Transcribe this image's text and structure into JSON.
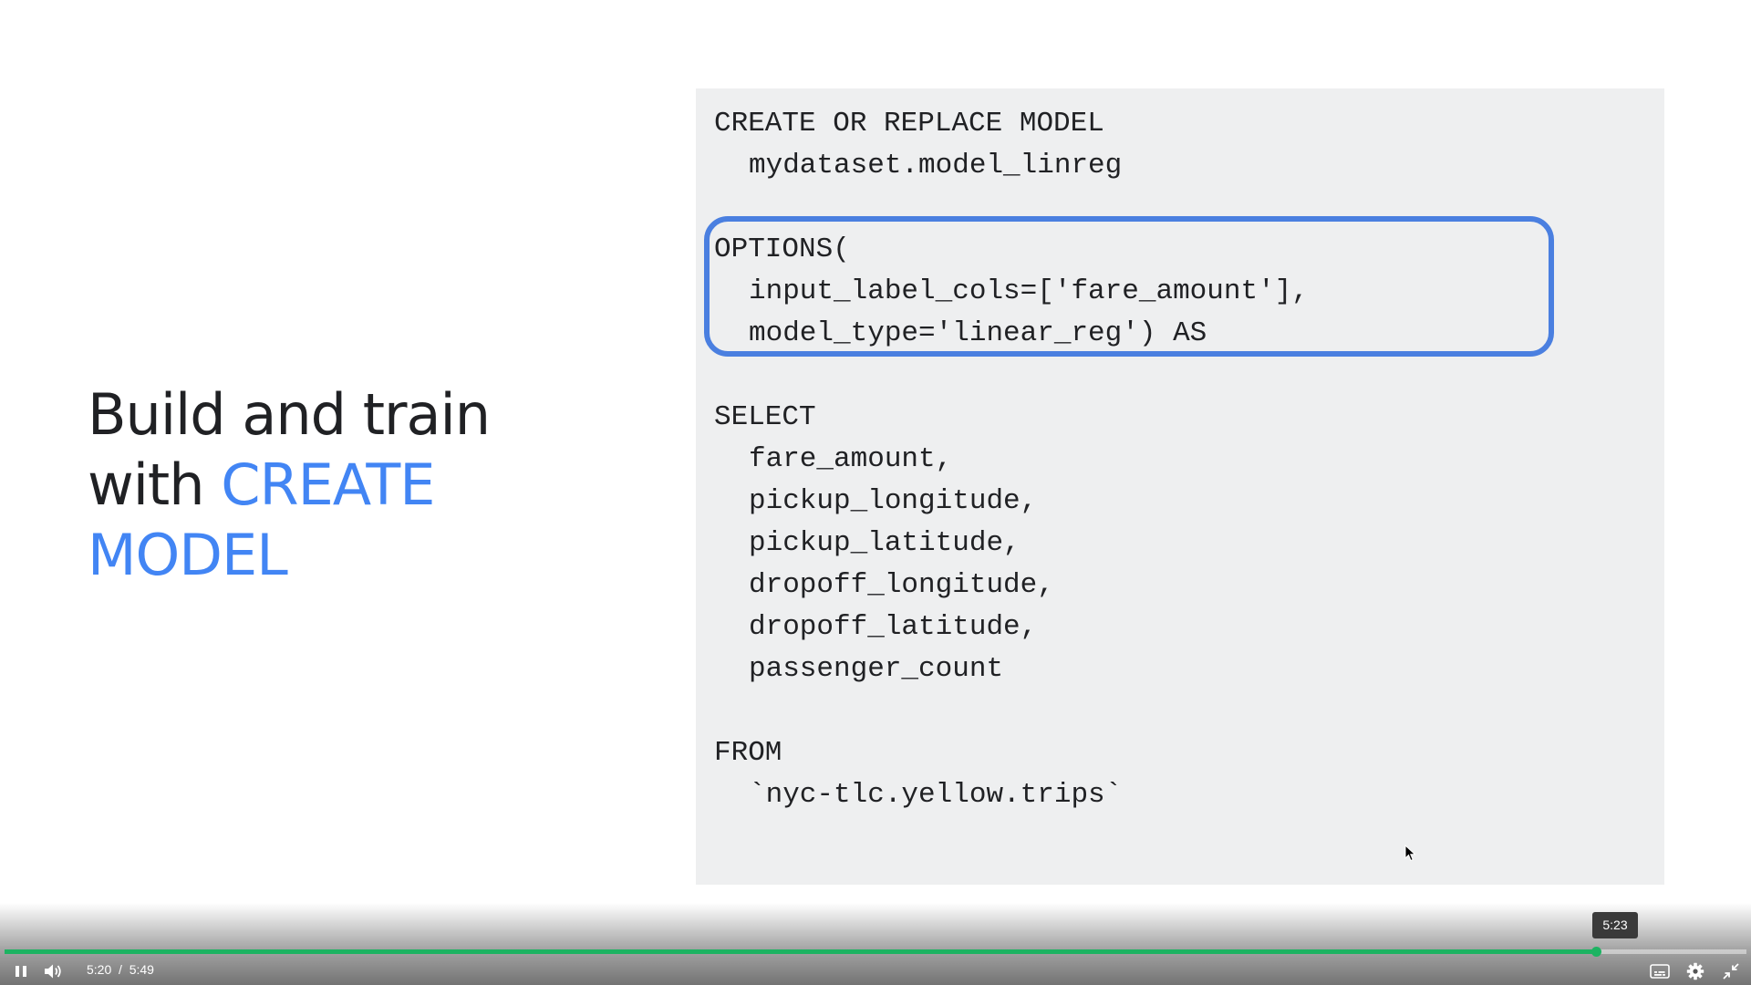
{
  "slide": {
    "heading_line1": "Build and train",
    "heading_line2_prefix": "with ",
    "heading_line2_accent": "CREATE",
    "heading_line3_accent": "MODEL"
  },
  "code": {
    "line1": "CREATE OR REPLACE MODEL",
    "line2": "mydataset.model_linreg",
    "line3": "OPTIONS(",
    "line4": "input_label_cols=['fare_amount'],",
    "line5": "model_type='linear_reg') AS",
    "line6": "SELECT",
    "line7": "fare_amount,",
    "line8": "pickup_longitude,",
    "line9": "pickup_latitude,",
    "line10": "dropoff_longitude,",
    "line11": "dropoff_latitude,",
    "line12": "passenger_count",
    "line13": "FROM",
    "line14": "`nyc-tlc.yellow.trips`"
  },
  "player": {
    "current_time": "5:20",
    "separator": "/",
    "duration": "5:49",
    "hover_time": "5:23",
    "progress_fraction": 0.9138,
    "icons": [
      "pause-icon",
      "volume-icon",
      "captions-icon",
      "settings-icon",
      "exit-fullscreen-icon"
    ]
  },
  "colors": {
    "accent": "#4285f4",
    "highlight_box": "#4a7fe0",
    "progress": "#1db362",
    "code_background": "#eeeff0"
  }
}
